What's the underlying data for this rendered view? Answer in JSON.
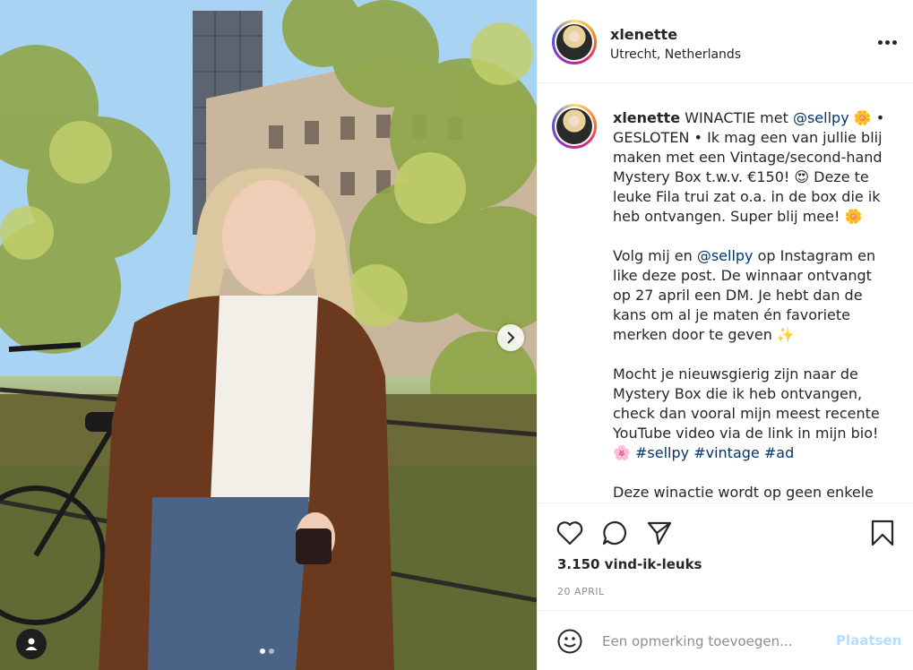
{
  "post": {
    "username": "xlenette",
    "location": "Utrecht, Netherlands",
    "caption": {
      "p1_a": "WINACTIE met ",
      "mention1": "@sellpy",
      "p1_b": " 🌼 • GESLOTEN • Ik mag een van jullie blij maken met een Vintage/second-hand Mystery Box t.w.v. €150! 😍 Deze te leuke Fila trui zat o.a. in de box die ik heb ontvangen. Super blij mee! 🌼",
      "p2_a": "Volg mij en ",
      "mention2": "@sellpy",
      "p2_b": " op Instagram en like deze post. De winnaar ontvangt op 27 april een DM. Je hebt dan de kans om al je maten én favoriete merken door te geven ✨",
      "p3": "Mocht je nieuwsgierig zijn naar de Mystery Box die ik heb ontvangen, check dan vooral mijn meest recente YouTube video via de link in mijn bio!",
      "p3_emoji": "🌸 ",
      "hashtag1": "#sellpy",
      "hashtag2": "#vintage",
      "hashtag3": "#ad",
      "p4": "Deze winactie wordt op geen enkele"
    },
    "likes_text": "3.150 vind-ik-leuks",
    "date_text": "20 APRIL",
    "comment_placeholder": "Een opmerking toevoegen...",
    "post_button_label": "Plaatsen",
    "carousel": {
      "total": 2,
      "current": 1
    }
  },
  "icons": {
    "like": "heart-icon",
    "comment": "comment-icon",
    "share": "paper-plane-icon",
    "save": "bookmark-icon",
    "emoji": "smiley-icon",
    "more": "more-options-icon",
    "next": "chevron-right-icon",
    "tags": "user-tag-icon"
  },
  "colors": {
    "link": "#00376b",
    "post_button_disabled": "#b2dffc",
    "secondary_text": "#8e8e8e",
    "divider": "#efefef"
  }
}
